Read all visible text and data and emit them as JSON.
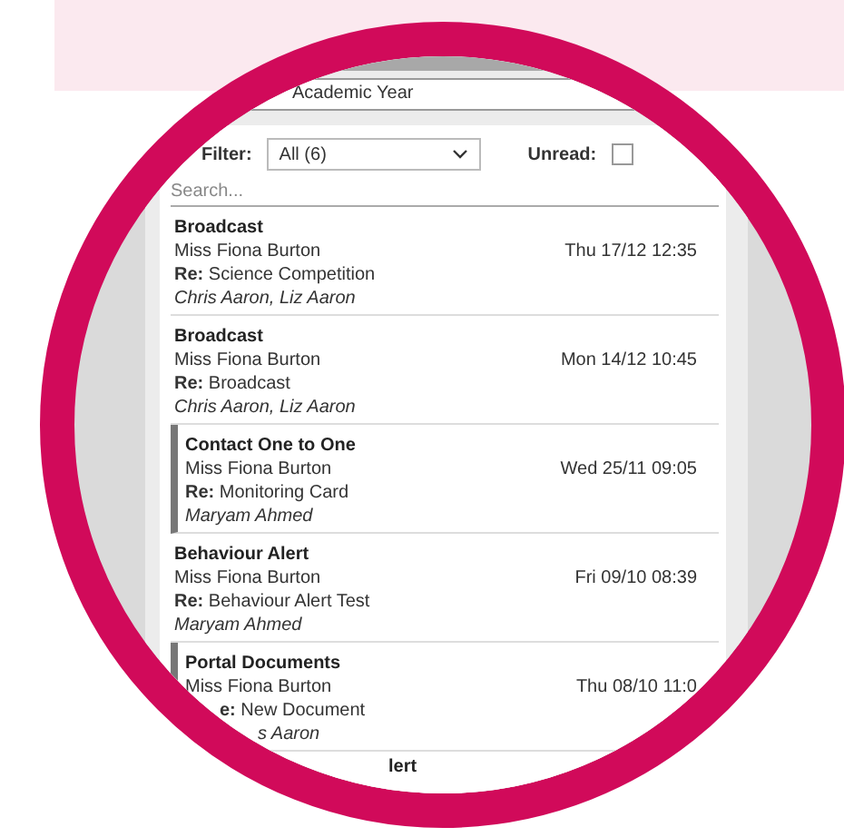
{
  "year_selector": {
    "value": "Academic Year"
  },
  "filter": {
    "label": "Filter:",
    "value": "All (6)"
  },
  "unread_filter": {
    "label": "Unread:",
    "checked": false
  },
  "search": {
    "placeholder": "Search..."
  },
  "messages": [
    {
      "type": "Broadcast",
      "sender": "Miss Fiona Burton",
      "date": "Thu 17/12 12:35",
      "subject": "**Re:** Science Competition",
      "recipients": "Chris Aaron, Liz Aaron",
      "unread": false
    },
    {
      "type": "Broadcast",
      "sender": "Miss Fiona Burton",
      "date": "Mon 14/12 10:45",
      "subject": "**Re:** Broadcast",
      "recipients": "Chris Aaron, Liz Aaron",
      "unread": false
    },
    {
      "type": "Contact One to One",
      "sender": "Miss Fiona Burton",
      "date": "Wed 25/11 09:05",
      "subject": "**Re:** Monitoring Card",
      "recipients": "Maryam Ahmed",
      "unread": true
    },
    {
      "type": "Behaviour Alert",
      "sender": "Miss Fiona Burton",
      "date": "Fri 09/10 08:39",
      "subject": "**Re:** Behaviour Alert Test",
      "recipients": "Maryam Ahmed",
      "unread": false
    },
    {
      "type": "Portal Documents",
      "sender": "Miss Fiona Burton",
      "date": "Thu 08/10 11:0",
      "subject": "**e:** New Document",
      "recipients": "s Aaron",
      "unread": true
    },
    {
      "type": "lert"
    }
  ]
}
